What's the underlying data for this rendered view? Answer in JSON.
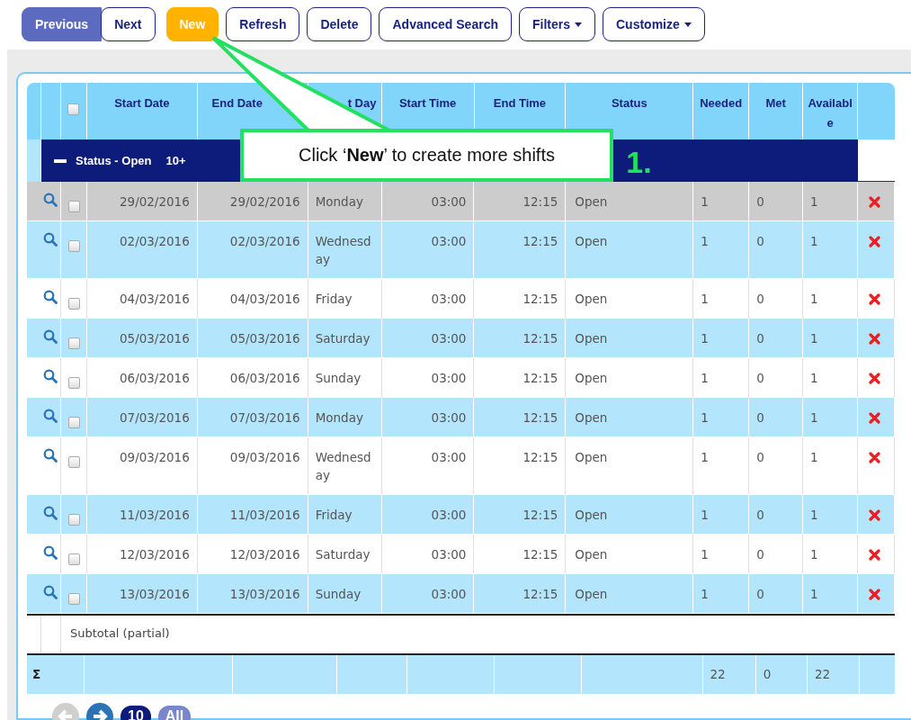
{
  "toolbar": [
    {
      "label": "Previous",
      "kind": "filled",
      "dropdown": false
    },
    {
      "label": "Next",
      "kind": "outline",
      "dropdown": false
    },
    {
      "label": "New",
      "kind": "accent",
      "dropdown": false
    },
    {
      "label": "Refresh",
      "kind": "outline",
      "dropdown": false
    },
    {
      "label": "Delete",
      "kind": "outline",
      "dropdown": false
    },
    {
      "label": "Advanced Search",
      "kind": "outline",
      "dropdown": false
    },
    {
      "label": "Filters",
      "kind": "outline",
      "dropdown": true
    },
    {
      "label": "Customize",
      "kind": "outline",
      "dropdown": true
    }
  ],
  "table": {
    "select_all_checked": false,
    "columns": [
      "Start Date",
      "End Date",
      "t Day",
      "Start Time",
      "End Time",
      "Status",
      "Needed",
      "Met",
      "Available"
    ],
    "group": {
      "label": "Status - Open",
      "count": "10+",
      "expanded": true
    },
    "rows": [
      {
        "start_date": "29/02/2016",
        "end_date": "29/02/2016",
        "day": "Monday",
        "start_time": "03:00",
        "end_time": "12:15",
        "status": "Open",
        "needed": "1",
        "met": "0",
        "available": "1",
        "checked": false,
        "selected": true
      },
      {
        "start_date": "02/03/2016",
        "end_date": "02/03/2016",
        "day": "Wednesday",
        "start_time": "03:00",
        "end_time": "12:15",
        "status": "Open",
        "needed": "1",
        "met": "0",
        "available": "1",
        "checked": false,
        "selected": false
      },
      {
        "start_date": "04/03/2016",
        "end_date": "04/03/2016",
        "day": "Friday",
        "start_time": "03:00",
        "end_time": "12:15",
        "status": "Open",
        "needed": "1",
        "met": "0",
        "available": "1",
        "checked": false,
        "selected": false
      },
      {
        "start_date": "05/03/2016",
        "end_date": "05/03/2016",
        "day": "Saturday",
        "start_time": "03:00",
        "end_time": "12:15",
        "status": "Open",
        "needed": "1",
        "met": "0",
        "available": "1",
        "checked": false,
        "selected": false
      },
      {
        "start_date": "06/03/2016",
        "end_date": "06/03/2016",
        "day": "Sunday",
        "start_time": "03:00",
        "end_time": "12:15",
        "status": "Open",
        "needed": "1",
        "met": "0",
        "available": "1",
        "checked": false,
        "selected": false
      },
      {
        "start_date": "07/03/2016",
        "end_date": "07/03/2016",
        "day": "Monday",
        "start_time": "03:00",
        "end_time": "12:15",
        "status": "Open",
        "needed": "1",
        "met": "0",
        "available": "1",
        "checked": false,
        "selected": false
      },
      {
        "start_date": "09/03/2016",
        "end_date": "09/03/2016",
        "day": "Wednesday",
        "start_time": "03:00",
        "end_time": "12:15",
        "status": "Open",
        "needed": "1",
        "met": "0",
        "available": "1",
        "checked": false,
        "selected": false
      },
      {
        "start_date": "11/03/2016",
        "end_date": "11/03/2016",
        "day": "Friday",
        "start_time": "03:00",
        "end_time": "12:15",
        "status": "Open",
        "needed": "1",
        "met": "0",
        "available": "1",
        "checked": false,
        "selected": false
      },
      {
        "start_date": "12/03/2016",
        "end_date": "12/03/2016",
        "day": "Saturday",
        "start_time": "03:00",
        "end_time": "12:15",
        "status": "Open",
        "needed": "1",
        "met": "0",
        "available": "1",
        "checked": false,
        "selected": false
      },
      {
        "start_date": "13/03/2016",
        "end_date": "13/03/2016",
        "day": "Sunday",
        "start_time": "03:00",
        "end_time": "12:15",
        "status": "Open",
        "needed": "1",
        "met": "0",
        "available": "1",
        "checked": false,
        "selected": false
      }
    ],
    "subtotal_label": "Subtotal (partial)",
    "totals": {
      "symbol": "Σ",
      "needed": "22",
      "met": "0",
      "available": "22"
    }
  },
  "pager": {
    "prev_disabled": true,
    "next_disabled": false,
    "page_sizes": [
      {
        "label": "10",
        "selected": true
      },
      {
        "label": "All",
        "selected": false
      }
    ]
  },
  "callout": {
    "text": "Click ‘**New**’ to create more shifts",
    "step": "1."
  }
}
